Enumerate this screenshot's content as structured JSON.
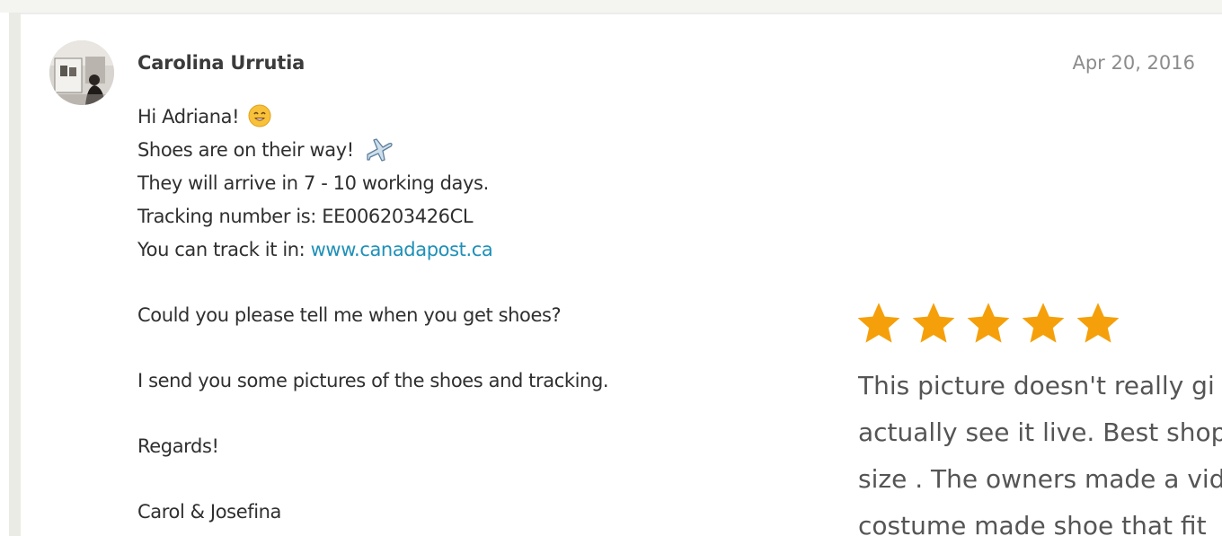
{
  "message": {
    "sender_name": "Carolina Urrutia",
    "date": "Apr 20, 2016",
    "lines": {
      "greeting": "Hi Adriana!",
      "shipping": "Shoes are on their way!",
      "arrival": "They will arrive in 7 - 10 working days.",
      "tracking": "Tracking number is: EE006203426CL",
      "track_prefix": "You can track it in: ",
      "track_link": "www.canadapost.ca",
      "request": "Could you please tell me when you get shoes?",
      "pictures": "I send you some pictures of the shoes and tracking.",
      "regards": "Regards!",
      "signature": "Carol & Josefina"
    },
    "icons": {
      "greeting_emoji": "smile-emoji-icon",
      "shipping_emoji": "airplane-emoji-icon"
    }
  },
  "review": {
    "rating": 5,
    "rating_max": 5,
    "star_color": "#f5a00a",
    "lines": [
      "This picture doesn't really gi",
      "actually see it live. Best shop",
      "size . The owners made a vid",
      "costume made shoe that fit"
    ]
  },
  "colors": {
    "link": "#1e90b8",
    "text": "#2f2f2f",
    "date": "#8c8c8c",
    "review_text": "#555555"
  }
}
